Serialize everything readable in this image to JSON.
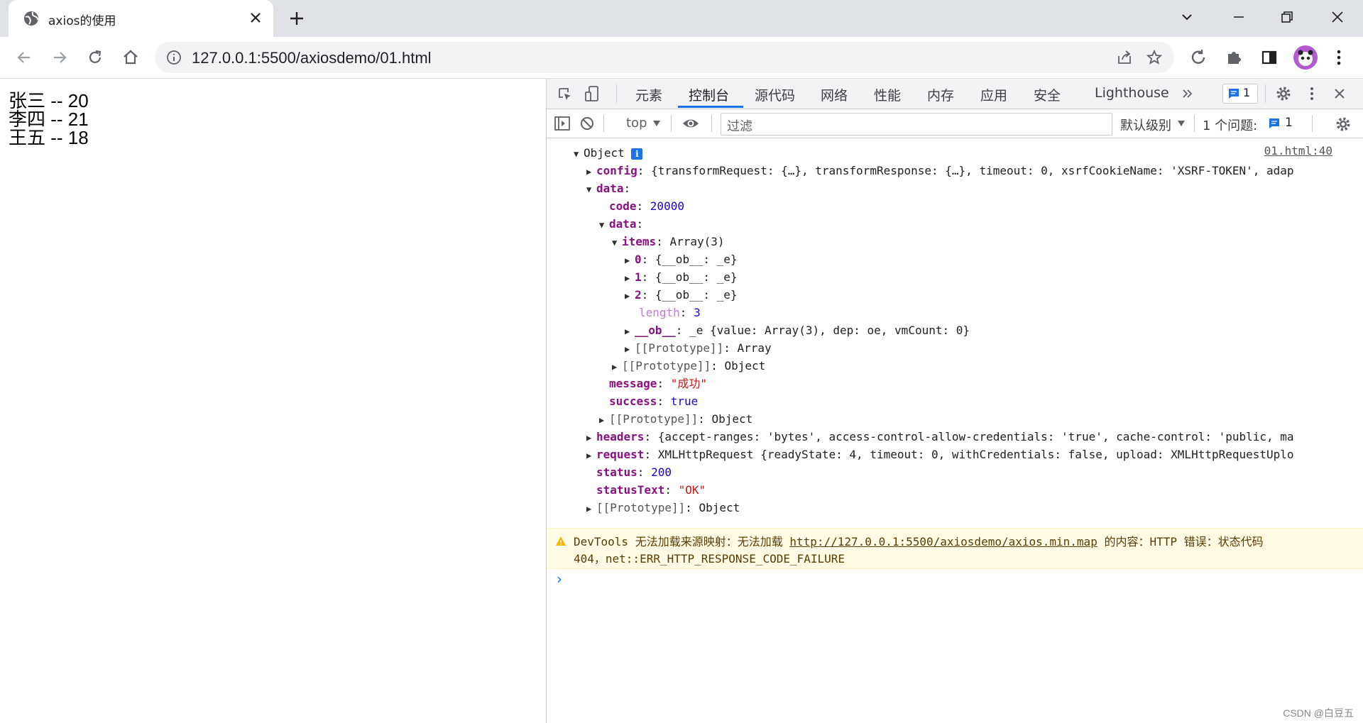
{
  "tab": {
    "title": "axios的使用"
  },
  "address": {
    "url": "127.0.0.1:5500/axiosdemo/01.html"
  },
  "page": {
    "people": [
      {
        "text": "张三 -- 20"
      },
      {
        "text": "李四 -- 21"
      },
      {
        "text": "王五 -- 18"
      }
    ]
  },
  "devtools": {
    "tabs": [
      "元素",
      "控制台",
      "源代码",
      "网络",
      "性能",
      "内存",
      "应用",
      "安全",
      "Lighthouse"
    ],
    "active_tab": "控制台",
    "issue_count": "1",
    "context": "top",
    "filter_placeholder": "过滤",
    "level": "默认级别",
    "issues_label": "1 个问题:",
    "issues_count": "1",
    "source_link": "01.html:40",
    "log": {
      "root": "Object",
      "config_key": "config",
      "config_val": "{transformRequest: {…}, transformResponse: {…}, timeout: 0, xsrfCookieName: 'XSRF-TOKEN', adap",
      "data_key": "data",
      "code_key": "code",
      "code_val": "20000",
      "inner_data_key": "data",
      "items_key": "items",
      "items_val": "Array(3)",
      "item0": "{__ob__: _e}",
      "item1": "{__ob__: _e}",
      "item2": "{__ob__: _e}",
      "length_key": "length",
      "length_val": "3",
      "ob_key": "__ob__",
      "ob_val": "_e {value: Array(3), dep: oe, vmCount: 0}",
      "proto_array": "Array",
      "proto_object": "Object",
      "message_key": "message",
      "message_val": "\"成功\"",
      "success_key": "success",
      "success_val": "true",
      "headers_key": "headers",
      "headers_val": "{accept-ranges: 'bytes', access-control-allow-credentials: 'true', cache-control: 'public, ma",
      "request_key": "request",
      "request_val": "XMLHttpRequest {readyState: 4, timeout: 0, withCredentials: false, upload: XMLHttpRequestUplo",
      "status_key": "status",
      "status_val": "200",
      "statustext_key": "statusText",
      "statustext_val": "\"OK\""
    },
    "warning": {
      "prefix": "DevTools 无法加载来源映射：无法加载 ",
      "url": "http://127.0.0.1:5500/axiosdemo/axios.min.map",
      "suffix": " 的内容：HTTP 错误：状态代码",
      "line2": "404，net::ERR_HTTP_RESPONSE_CODE_FAILURE"
    }
  },
  "watermark": "CSDN @白豆五"
}
